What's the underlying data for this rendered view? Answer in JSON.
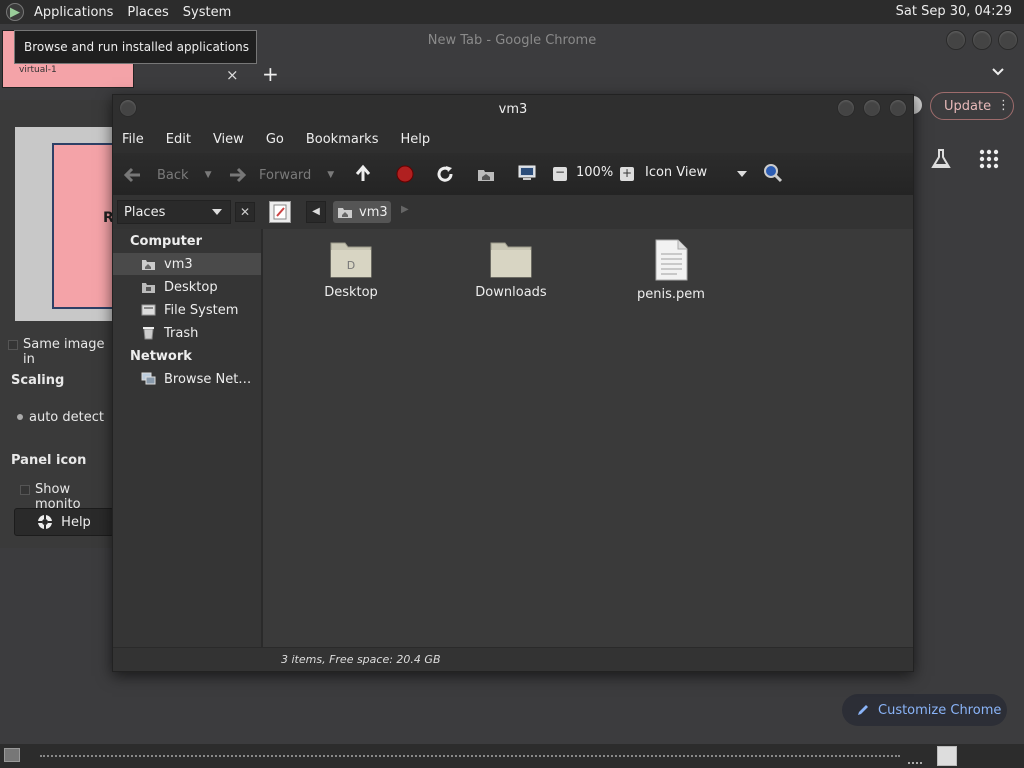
{
  "top_panel": {
    "menu": [
      "Applications",
      "Places",
      "System"
    ],
    "clock": "Sat Sep 30, 04:29"
  },
  "tooltip": "Browse and run installed applications",
  "chrome": {
    "title": "New Tab - Google Chrome",
    "thumb_label": "virtual-1",
    "tab_close": "×",
    "new_tab": "+",
    "update_label": "Update",
    "customize_label": "Customize Chrome"
  },
  "left_panel": {
    "preview_letter": "R",
    "same_image": "Same image in",
    "scaling": "Scaling",
    "auto_detect": "auto detect",
    "panel_icon": "Panel icon",
    "show_monitor": "Show monito",
    "help": "Help"
  },
  "file_manager": {
    "title": "vm3",
    "menu": [
      "File",
      "Edit",
      "View",
      "Go",
      "Bookmarks",
      "Help"
    ],
    "toolbar": {
      "back": "Back",
      "forward": "Forward",
      "zoom": "100%",
      "view_mode": "Icon View"
    },
    "places_label": "Places",
    "breadcrumb": "vm3",
    "sidebar": {
      "computer_head": "Computer",
      "computer_items": [
        "vm3",
        "Desktop",
        "File System",
        "Trash"
      ],
      "network_head": "Network",
      "network_items": [
        "Browse Net…"
      ]
    },
    "files": [
      {
        "name": "Desktop",
        "icon": "folder-desktop-icon"
      },
      {
        "name": "Downloads",
        "icon": "folder-icon"
      },
      {
        "name": "penis.pem",
        "icon": "text-file-icon"
      }
    ],
    "status": "3 items, Free space: 20.4 GB"
  }
}
